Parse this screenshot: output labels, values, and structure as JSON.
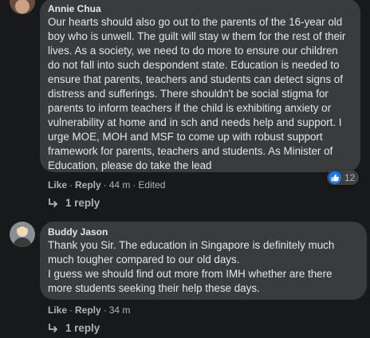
{
  "comments": [
    {
      "author": "Annie Chua",
      "text": "Our hearts should also go out to the parents of the 16-year old boy who is unwell. The guilt will stay w them for the rest of their lives. As a society, we need to do more to ensure our children do not fall into such despondent state. Education is needed to ensure that parents, teachers and students can detect signs of distress and sufferings. There shouldn't be social stigma for parents to inform teachers if the child is exhibiting anxiety or vulnerability at home and in sch and needs help and support. I urge MOE, MOH and MSF to come up with robust support framework for parents, teachers and students. As Minister of Education, please do take the lead",
      "like_label": "Like",
      "reply_label": "Reply",
      "time": "44 m",
      "edited": "Edited",
      "reaction_count": "12",
      "replies_label": "1 reply"
    },
    {
      "author": "Buddy Jason",
      "paragraphs": [
        "Thank you Sir. The education in Singapore is definitely much much tougher compared to our old days.",
        "I guess we should find out more from IMH whether are there more students seeking their help these days."
      ],
      "like_label": "Like",
      "reply_label": "Reply",
      "time": "34 m",
      "replies_label": "1 reply"
    }
  ],
  "colors": {
    "background": "#18191a",
    "bubble": "#3a3b3c",
    "text": "#e4e6eb",
    "secondary_text": "#b0b3b8",
    "like_blue": "#1877f2"
  },
  "icons": {
    "reaction": "thumbs-up-icon",
    "replies": "reply-arrow-icon"
  }
}
